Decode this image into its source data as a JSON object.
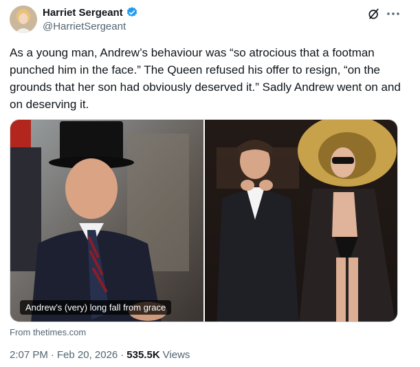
{
  "author": {
    "name": "Harriet Sergeant",
    "handle": "@HarrietSergeant",
    "verified": true,
    "verified_color": "#1d9bf0"
  },
  "tweet": {
    "text": "As a young man, Andrew’s behaviour was “so atrocious that a footman punched him in the face.” The Queen refused his offer to resign, “on the grounds that her son had obviously deserved it.” Sadly Andrew went on and on deserving it."
  },
  "media": {
    "caption": "Andrew’s (very) long fall from grace",
    "source": "From thetimes.com"
  },
  "meta": {
    "time": "2:07 PM",
    "separator": "·",
    "date": "Feb 20, 2026",
    "views_count": "535.5K",
    "views_label": "Views"
  },
  "icons": {
    "grok": "grok-icon",
    "more": "more-icon",
    "verified": "verified-badge-icon"
  }
}
